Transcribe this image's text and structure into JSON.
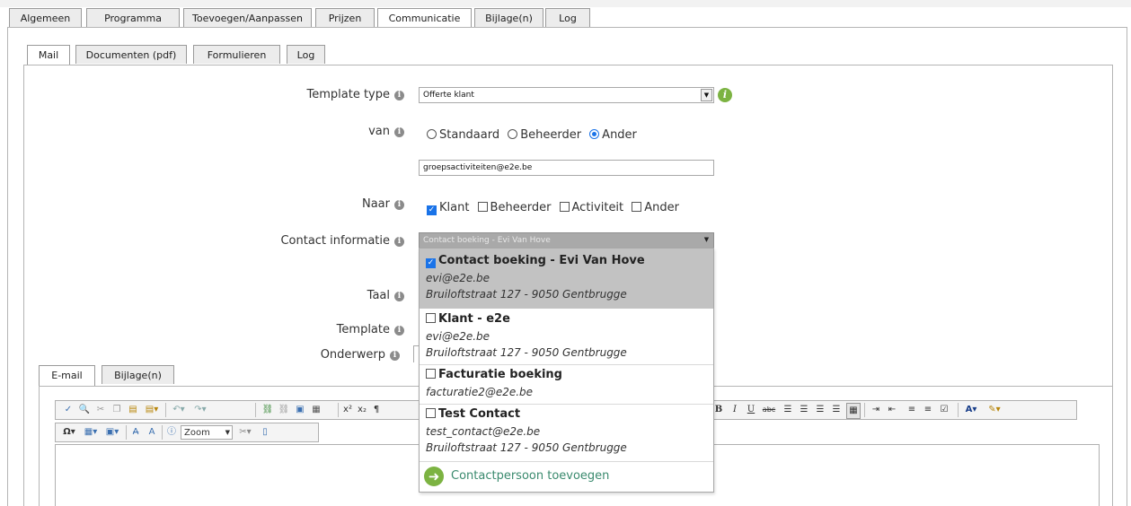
{
  "top_tabs": [
    "Algemeen",
    "Programma",
    "Toevoegen/Aanpassen",
    "Prijzen",
    "Communicatie",
    "Bijlage(n)",
    "Log"
  ],
  "sub_tabs": [
    "Mail",
    "Documenten (pdf)",
    "Formulieren",
    "Log"
  ],
  "form": {
    "template_type_label": "Template type",
    "template_type_value": "Offerte klant",
    "van_label": "van",
    "van_options": [
      "Standaard",
      "Beheerder",
      "Ander"
    ],
    "van_selected": "Ander",
    "van_email": "groepsactiviteiten@e2e.be",
    "naar_label": "Naar",
    "naar_options": [
      "Klant",
      "Beheerder",
      "Activiteit",
      "Ander"
    ],
    "naar_checked": [
      "Klant"
    ],
    "contact_label": "Contact informatie",
    "contact_value": "Contact boeking - Evi Van Hove",
    "taal_label": "Taal",
    "template_label": "Template",
    "onderwerp_label": "Onderwerp"
  },
  "contacts": [
    {
      "name": "Contact boeking - Evi Van Hove",
      "email": "evi@e2e.be",
      "address": "Bruiloftstraat 127 - 9050 Gentbrugge",
      "checked": true
    },
    {
      "name": "Klant - e2e",
      "email": "evi@e2e.be",
      "address": "Bruiloftstraat 127 - 9050 Gentbrugge",
      "checked": false
    },
    {
      "name": "Facturatie boeking",
      "email": "facturatie2@e2e.be",
      "address": "",
      "checked": false
    },
    {
      "name": "Test Contact",
      "email": "test_contact@e2e.be",
      "address": "Bruiloftstraat 127 - 9050 Gentbrugge",
      "checked": false
    }
  ],
  "add_contact_label": "Contactpersoon toevoegen",
  "editor_tabs": [
    "E-mail",
    "Bijlage(n)"
  ],
  "toolbar": {
    "zoom_label": "Zoom",
    "bold": "B",
    "italic": "I",
    "underline": "U",
    "omega": "Ω"
  },
  "colors": {
    "accent_green": "#7cb342",
    "checkbox_blue": "#1a73e8",
    "selected_row": "#c2c2c2"
  }
}
